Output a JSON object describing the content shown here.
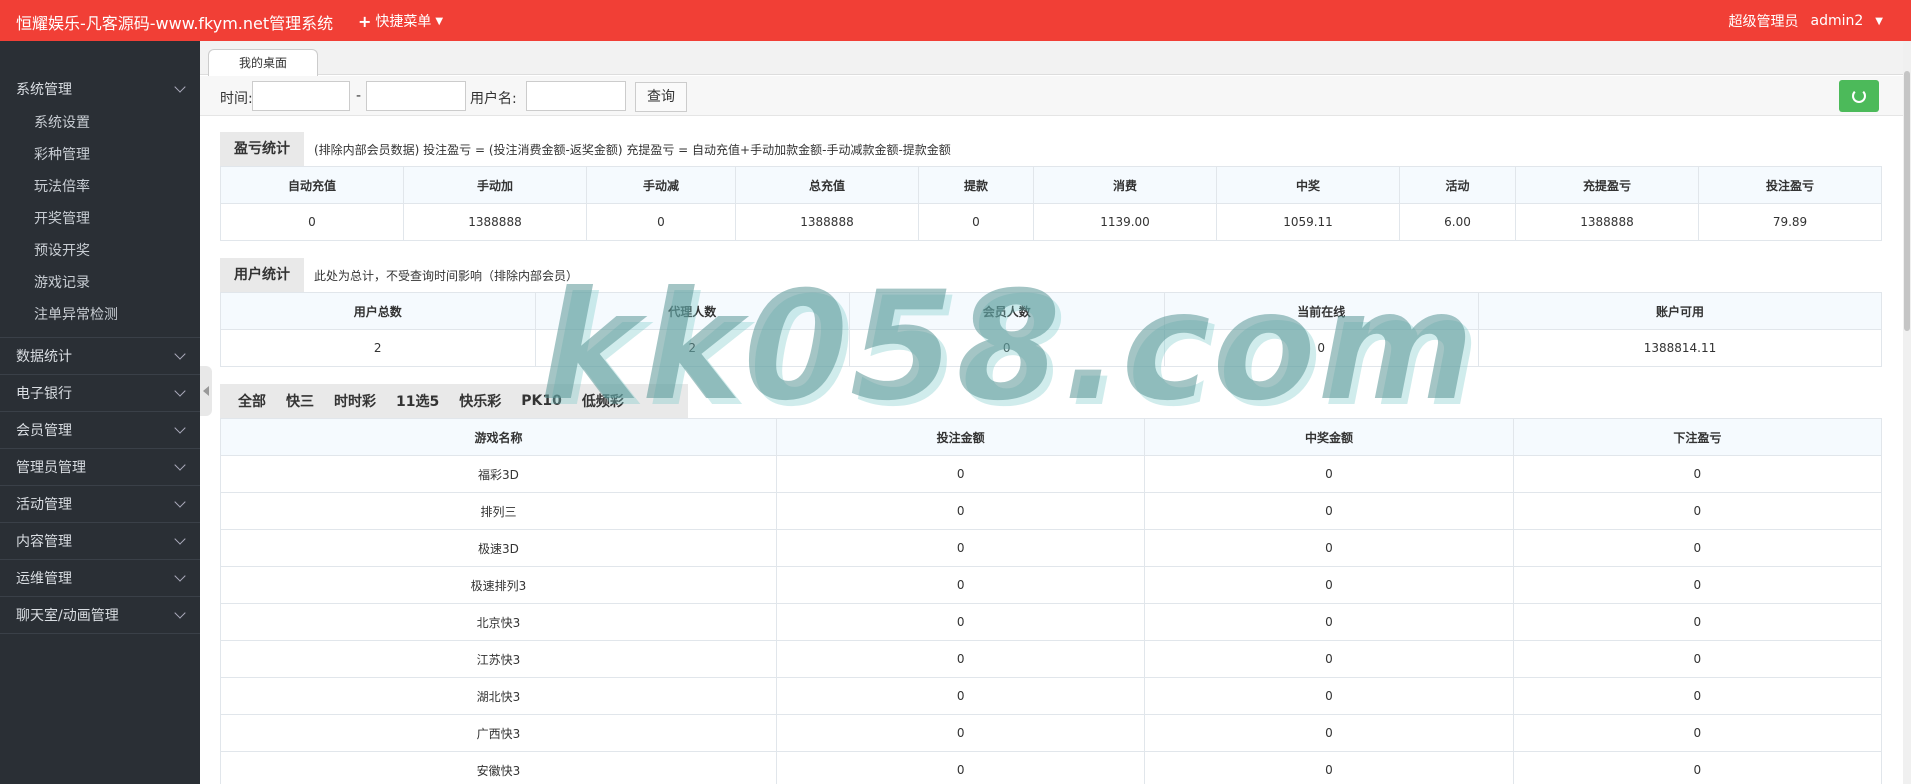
{
  "header": {
    "brand": "恒耀娱乐-凡客源码-www.fkym.net管理系统",
    "quick_menu": "快捷菜单",
    "role": "超级管理员",
    "username": "admin2"
  },
  "sidebar": {
    "groups": [
      {
        "label": "系统管理",
        "items": [
          "系统设置",
          "彩种管理",
          "玩法倍率",
          "开奖管理",
          "预设开奖",
          "游戏记录",
          "注单异常检测"
        ]
      },
      {
        "label": "数据统计"
      },
      {
        "label": "电子银行"
      },
      {
        "label": "会员管理"
      },
      {
        "label": "管理员管理"
      },
      {
        "label": "活动管理"
      },
      {
        "label": "内容管理"
      },
      {
        "label": "运维管理"
      },
      {
        "label": "聊天室/动画管理"
      }
    ]
  },
  "tab": {
    "label": "我的桌面"
  },
  "search": {
    "time_label": "时间:",
    "dash": "-",
    "user_label": "用户名:",
    "query_button": "查询"
  },
  "profit": {
    "title": "盈亏统计",
    "note": "(排除内部会员数据)  投注盈亏 = (投注消费金额-返奖金额)    充提盈亏 = 自动充值+手动加款金额-手动减款金额-提款金额",
    "headers": [
      "自动充值",
      "手动加",
      "手动减",
      "总充值",
      "提款",
      "消费",
      "中奖",
      "活动",
      "充提盈亏",
      "投注盈亏"
    ],
    "values": [
      "0",
      "1388888",
      "0",
      "1388888",
      "0",
      "1139.00",
      "1059.11",
      "6.00",
      "1388888",
      "79.89"
    ]
  },
  "users": {
    "title": "用户统计",
    "note": "此处为总计，不受查询时间影响（排除内部会员）",
    "headers": [
      "用户总数",
      "代理人数",
      "会员人数",
      "当前在线",
      "账户可用"
    ],
    "values": [
      "2",
      "2",
      "0",
      "0",
      "1388814.11"
    ]
  },
  "game_tabs": [
    "全部",
    "快三",
    "时时彩",
    "11选5",
    "快乐彩",
    "PK10",
    "低频彩"
  ],
  "games": {
    "headers": [
      "游戏名称",
      "投注金额",
      "中奖金额",
      "下注盈亏"
    ],
    "rows": [
      [
        "福彩3D",
        "0",
        "0",
        "0"
      ],
      [
        "排列三",
        "0",
        "0",
        "0"
      ],
      [
        "极速3D",
        "0",
        "0",
        "0"
      ],
      [
        "极速排列3",
        "0",
        "0",
        "0"
      ],
      [
        "北京快3",
        "0",
        "0",
        "0"
      ],
      [
        "江苏快3",
        "0",
        "0",
        "0"
      ],
      [
        "湖北快3",
        "0",
        "0",
        "0"
      ],
      [
        "广西快3",
        "0",
        "0",
        "0"
      ],
      [
        "安徽快3",
        "0",
        "0",
        "0"
      ]
    ]
  },
  "watermark": "kk058.com",
  "colors": {
    "header": "#f13f36",
    "sidebar": "#2a2f35",
    "refresh": "#4cba5a"
  }
}
